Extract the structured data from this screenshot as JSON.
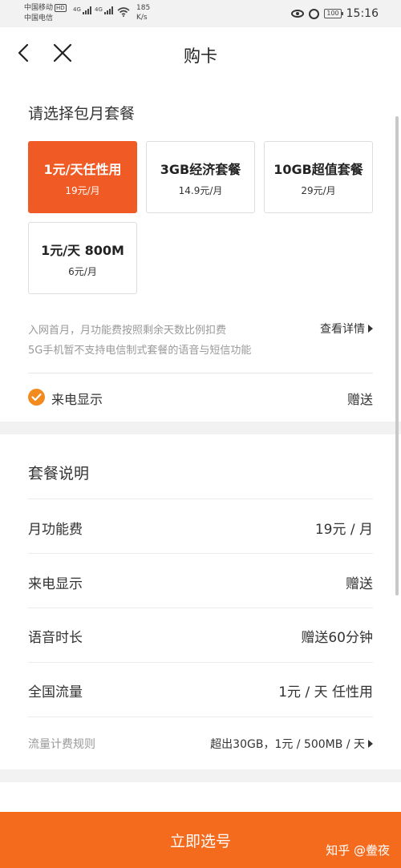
{
  "status_bar": {
    "carrier1": "中国移动",
    "hd_badge": "HD",
    "carrier2": "中国电信",
    "network1": "4G",
    "network2": "4G",
    "speed_value": "185",
    "speed_unit": "K/s",
    "battery": "100",
    "time": "15:16"
  },
  "header": {
    "title": "购卡"
  },
  "plans": {
    "section_title": "请选择包月套餐",
    "items": [
      {
        "name": "1元/天任性用",
        "price": "19元/月",
        "selected": true
      },
      {
        "name": "3GB经济套餐",
        "price": "14.9元/月",
        "selected": false
      },
      {
        "name": "10GB超值套餐",
        "price": "29元/月",
        "selected": false
      },
      {
        "name": "1元/天 800M",
        "price": "6元/月",
        "selected": false
      }
    ],
    "note_line1": "入网首月，月功能费按照剩余天数比例扣费",
    "note_line2": "5G手机暂不支持电信制式套餐的语音与短信功能",
    "detail_link": "查看详情",
    "caller_id_label": "来电显示",
    "caller_id_value": "赠送"
  },
  "description": {
    "title": "套餐说明",
    "rows": [
      {
        "label": "月功能费",
        "value": "19元 / 月"
      },
      {
        "label": "来电显示",
        "value": "赠送"
      },
      {
        "label": "语音时长",
        "value": "赠送60分钟"
      },
      {
        "label": "全国流量",
        "value": "1元 / 天 任性用"
      }
    ],
    "rule_label": "流量计费规则",
    "rule_value": "超出30GB，1元 / 500MB / 天"
  },
  "cta": {
    "label": "立即选号",
    "watermark": "知乎 @鲞夜"
  },
  "colors": {
    "accent": "#f05a24",
    "cta": "#f56b1e",
    "check": "#f28a1e"
  }
}
